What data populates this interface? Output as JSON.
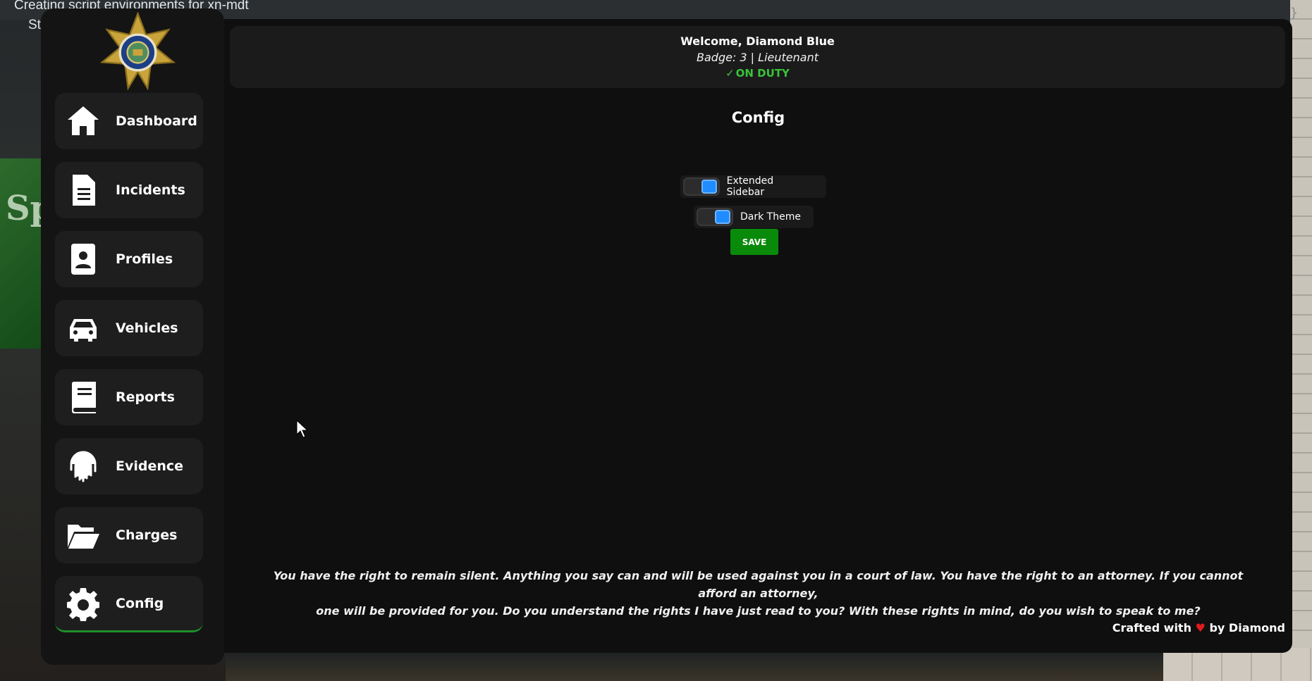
{
  "overlay": {
    "line1": "Creating script environments for xn-mdt",
    "line2": "St",
    "brace": "}"
  },
  "background": {
    "screen_text": "Sp"
  },
  "sidebar": {
    "items": [
      {
        "label": "Dashboard",
        "icon": "home-icon",
        "active": false
      },
      {
        "label": "Incidents",
        "icon": "document-icon",
        "active": false
      },
      {
        "label": "Profiles",
        "icon": "profile-icon",
        "active": false
      },
      {
        "label": "Vehicles",
        "icon": "car-icon",
        "active": false
      },
      {
        "label": "Reports",
        "icon": "book-icon",
        "active": false
      },
      {
        "label": "Evidence",
        "icon": "fingerprint-icon",
        "active": false
      },
      {
        "label": "Charges",
        "icon": "folder-open-icon",
        "active": false
      },
      {
        "label": "Config",
        "icon": "gear-icon",
        "active": true
      }
    ]
  },
  "header": {
    "welcome": "Welcome, Diamond Blue",
    "badge": "Badge: 3 | Lieutenant",
    "duty_status": "ON DUTY"
  },
  "config": {
    "title": "Config",
    "toggles": [
      {
        "label": "Extended Sidebar",
        "on": true
      },
      {
        "label": "Dark Theme",
        "on": true
      }
    ],
    "save_label": "SAVE"
  },
  "footer": {
    "rights_line1": "You have the right to remain silent. Anything you say can and will be used against you in a court of law. You have the right to an attorney. If you cannot afford an attorney,",
    "rights_line2": "one will be provided for you. Do you understand the rights I have just read to you? With these rights in mind, do you wish to speak to me?",
    "crafted_prefix": "Crafted with",
    "crafted_suffix": "by Diamond"
  },
  "colors": {
    "accent_green": "#1e8f2a",
    "on_duty": "#39c23a",
    "save_button": "#0a8a0a",
    "toggle_on": "#1f8cff",
    "heart": "#e01b1b",
    "panel_bg": "#0f0f0f",
    "sidebar_bg": "#141414"
  }
}
